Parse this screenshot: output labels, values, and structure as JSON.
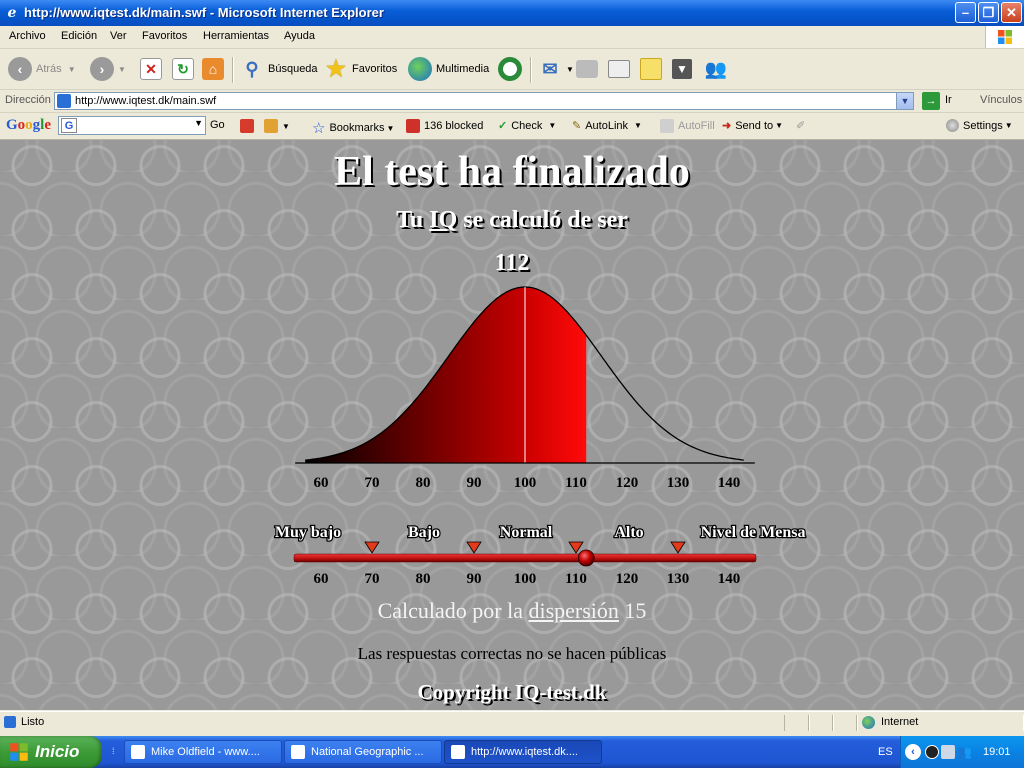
{
  "window": {
    "title": "http://www.iqtest.dk/main.swf - Microsoft Internet Explorer",
    "minimize": "–",
    "maximize": "❐",
    "close": "✕"
  },
  "menu": [
    "Archivo",
    "Edición",
    "Ver",
    "Favoritos",
    "Herramientas",
    "Ayuda"
  ],
  "toolbar": {
    "back": "Atrás",
    "search": "Búsqueda",
    "favorites": "Favoritos",
    "multimedia": "Multimedia"
  },
  "address": {
    "label": "Dirección",
    "url": "http://www.iqtest.dk/main.swf",
    "go": "Ir",
    "links": "Vínculos"
  },
  "google_bar": {
    "logo_letters": [
      "G",
      "o",
      "o",
      "g",
      "l",
      "e"
    ],
    "logo_colors": [
      "#2a5bd7",
      "#d8261c",
      "#e9a90a",
      "#2a5bd7",
      "#1f9a30",
      "#d8261c"
    ],
    "go": "Go",
    "bookmarks": "Bookmarks",
    "blocked": "136 blocked",
    "check": "Check",
    "autolink": "AutoLink",
    "autofill": "AutoFill",
    "sendto": "Send to",
    "settings": "Settings"
  },
  "content": {
    "heading": "El test ha finalizado",
    "subtitle_prefix": "Tu",
    "subtitle_link": "IQ",
    "subtitle_suffix": "se calculó de ser",
    "score": "112",
    "calc_prefix": "Calculado por la",
    "calc_link": "dispersión",
    "calc_suffix": "15",
    "not_public": "Las respuestas correctas no se hacen públicas",
    "copyright": "Copyright IQ-test.dk"
  },
  "chart_data": {
    "type": "area",
    "mean": 100,
    "sd": 15,
    "score": 112,
    "xlim": [
      60,
      140
    ],
    "ticks": [
      60,
      70,
      80,
      90,
      100,
      110,
      120,
      130,
      140
    ]
  },
  "scale": {
    "categories": [
      "Muy bajo",
      "Bajo",
      "Normal",
      "Alto",
      "Nivel de Mensa"
    ],
    "boundaries": [
      70,
      90,
      110,
      130
    ],
    "marker_value": 112,
    "ticks": [
      60,
      70,
      80,
      90,
      100,
      110,
      120,
      130,
      140
    ]
  },
  "status": {
    "text": "Listo",
    "zone": "Internet"
  },
  "taskbar": {
    "start": "Inicio",
    "tasks": [
      "Mike Oldfield - www....",
      "National Geographic ...",
      "http://www.iqtest.dk...."
    ],
    "lang": "ES",
    "time": "19:01"
  },
  "colors": {
    "curve_dark": "#000000",
    "curve_red": "#cc0000",
    "curve_bright": "#ff0a0a",
    "marker": "#e23a1a",
    "track": "#c81414"
  }
}
